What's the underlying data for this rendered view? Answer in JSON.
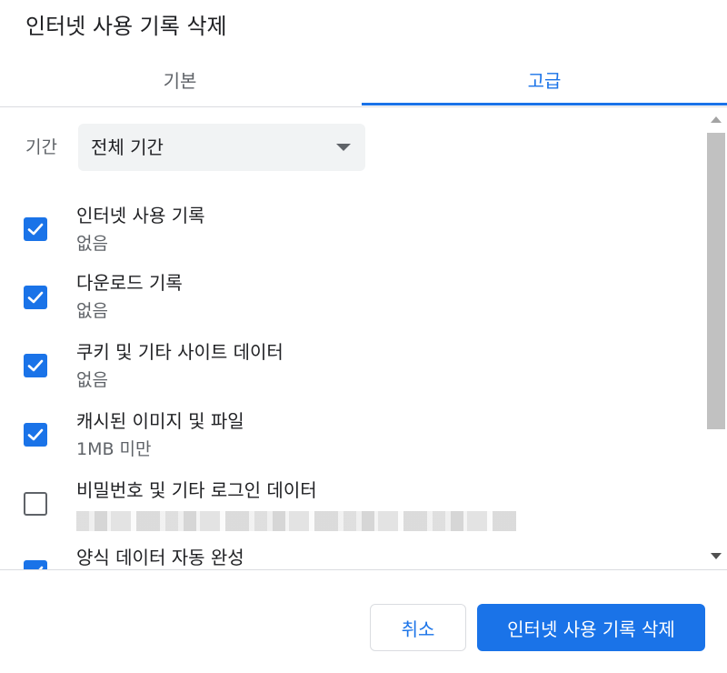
{
  "dialog": {
    "title": "인터넷 사용 기록 삭제"
  },
  "tabs": [
    {
      "label": "기본",
      "selected": false
    },
    {
      "label": "고급",
      "selected": true
    }
  ],
  "time_range": {
    "label": "기간",
    "value": "전체 기간"
  },
  "items": [
    {
      "label": "인터넷 사용 기록",
      "sub": "없음",
      "checked": true
    },
    {
      "label": "다운로드 기록",
      "sub": "없음",
      "checked": true
    },
    {
      "label": "쿠키 및 기타 사이트 데이터",
      "sub": "없음",
      "checked": true
    },
    {
      "label": "캐시된 이미지 및 파일",
      "sub": "1MB 미만",
      "checked": true
    },
    {
      "label": "비밀번호 및 기타 로그인 데이터",
      "sub": "",
      "checked": false,
      "sub_redacted": true
    },
    {
      "label": "양식 데이터 자동 완성",
      "sub": "",
      "checked": true
    }
  ],
  "buttons": {
    "cancel": "취소",
    "delete": "인터넷 사용 기록 삭제"
  },
  "colors": {
    "accent": "#1a73e8",
    "text": "#202124",
    "secondary_text": "#5f6368",
    "divider": "#dadce0"
  }
}
